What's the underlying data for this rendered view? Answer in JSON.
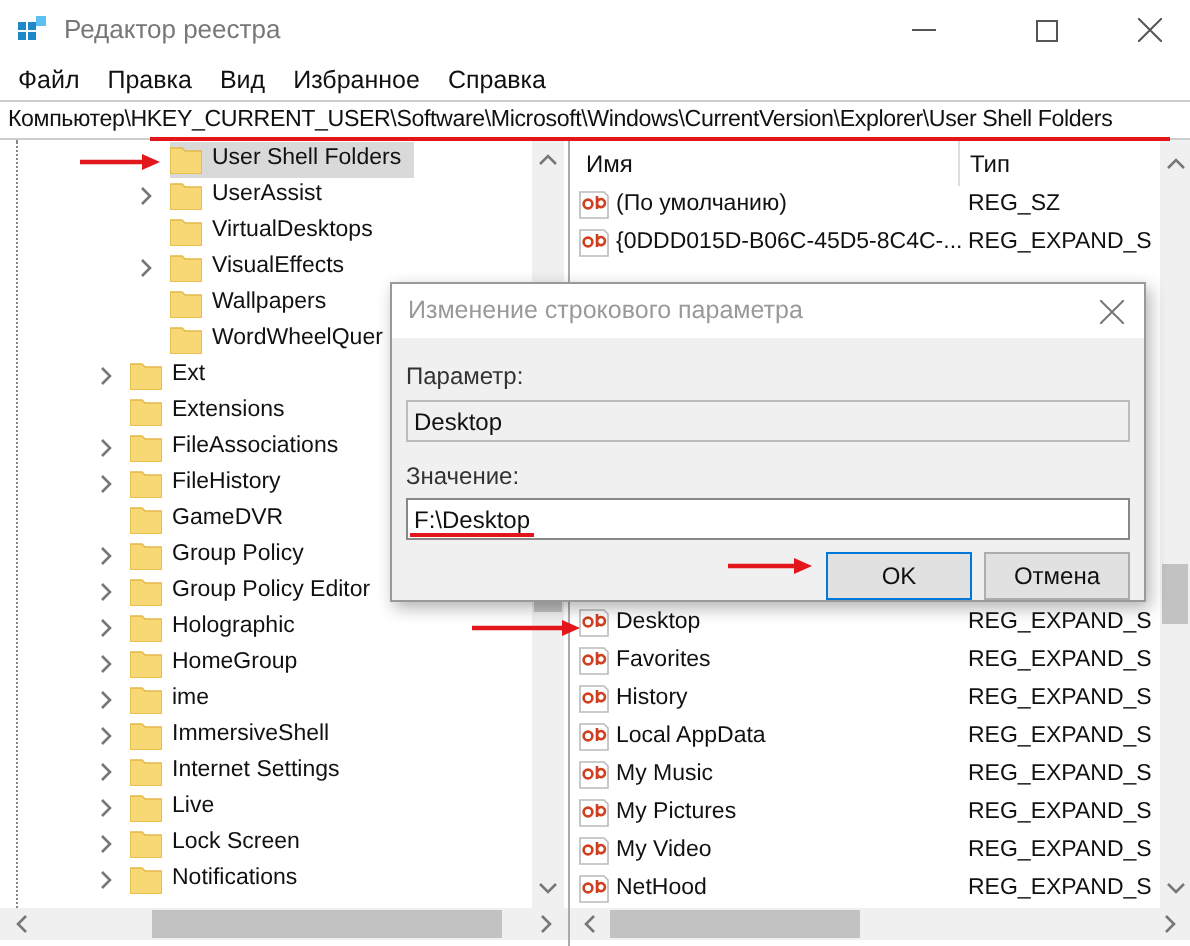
{
  "window": {
    "title": "Редактор реестра"
  },
  "menu": [
    "Файл",
    "Правка",
    "Вид",
    "Избранное",
    "Справка"
  ],
  "address": "Компьютер\\HKEY_CURRENT_USER\\Software\\Microsoft\\Windows\\CurrentVersion\\Explorer\\User Shell Folders",
  "tree": {
    "nested_items": [
      {
        "label": "User Shell Folders",
        "expandable": false,
        "selected": true
      },
      {
        "label": "UserAssist",
        "expandable": true,
        "selected": false
      },
      {
        "label": "VirtualDesktops",
        "expandable": false,
        "selected": false
      },
      {
        "label": "VisualEffects",
        "expandable": true,
        "selected": false
      },
      {
        "label": "Wallpapers",
        "expandable": false,
        "selected": false
      },
      {
        "label": "WordWheelQuer",
        "expandable": false,
        "selected": false
      }
    ],
    "items": [
      {
        "label": "Ext",
        "expandable": true,
        "selected": false
      },
      {
        "label": "Extensions",
        "expandable": false,
        "selected": false
      },
      {
        "label": "FileAssociations",
        "expandable": true,
        "selected": false
      },
      {
        "label": "FileHistory",
        "expandable": true,
        "selected": false
      },
      {
        "label": "GameDVR",
        "expandable": false,
        "selected": false
      },
      {
        "label": "Group Policy",
        "expandable": true,
        "selected": false
      },
      {
        "label": "Group Policy Editor",
        "expandable": true,
        "selected": false
      },
      {
        "label": "Holographic",
        "expandable": true,
        "selected": false
      },
      {
        "label": "HomeGroup",
        "expandable": true,
        "selected": false
      },
      {
        "label": "ime",
        "expandable": true,
        "selected": false
      },
      {
        "label": "ImmersiveShell",
        "expandable": true,
        "selected": false
      },
      {
        "label": "Internet Settings",
        "expandable": true,
        "selected": false
      },
      {
        "label": "Live",
        "expandable": true,
        "selected": false
      },
      {
        "label": "Lock Screen",
        "expandable": true,
        "selected": false
      },
      {
        "label": "Notifications",
        "expandable": true,
        "selected": false
      }
    ]
  },
  "values_table": {
    "columns": [
      "Имя",
      "Тип"
    ],
    "rows_top": [
      {
        "name": "(По умолчанию)",
        "type": "REG_SZ"
      },
      {
        "name": "{0DDD015D-B06C-45D5-8C4C-...",
        "type": "REG_EXPAND_S"
      }
    ],
    "rows_bottom": [
      {
        "name": "Desktop",
        "type": "REG_EXPAND_S"
      },
      {
        "name": "Favorites",
        "type": "REG_EXPAND_S"
      },
      {
        "name": "History",
        "type": "REG_EXPAND_S"
      },
      {
        "name": "Local AppData",
        "type": "REG_EXPAND_S"
      },
      {
        "name": "My Music",
        "type": "REG_EXPAND_S"
      },
      {
        "name": "My Pictures",
        "type": "REG_EXPAND_S"
      },
      {
        "name": "My Video",
        "type": "REG_EXPAND_S"
      },
      {
        "name": "NetHood",
        "type": "REG_EXPAND_S"
      }
    ]
  },
  "dialog": {
    "title": "Изменение строкового параметра",
    "name_label": "Параметр:",
    "name_value": "Desktop",
    "data_label": "Значение:",
    "data_value": "F:\\Desktop",
    "buttons": [
      {
        "label": "OK",
        "default": true
      },
      {
        "label": "Отмена",
        "default": false
      }
    ]
  }
}
